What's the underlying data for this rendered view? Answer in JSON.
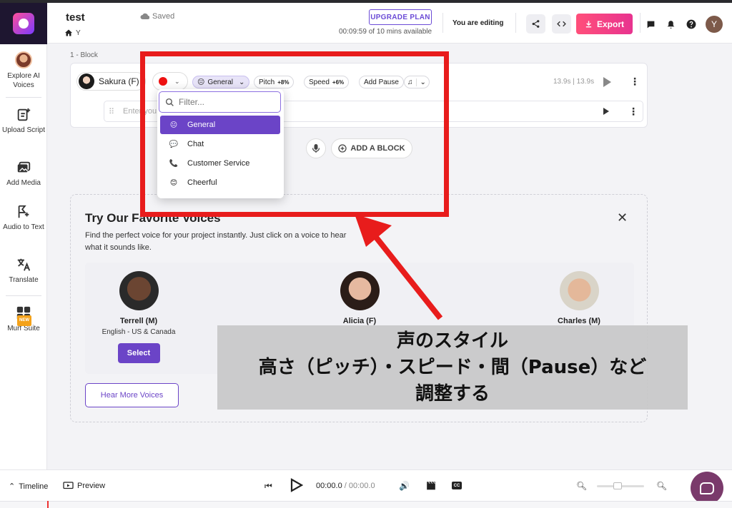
{
  "header": {
    "project_title": "test",
    "home_label": "Y",
    "saved_label": "Saved",
    "upgrade_label": "UPGRADE PLAN",
    "time_available": "00:09:59 of 10 mins available",
    "editing_label": "You are editing",
    "export_label": "Export",
    "user_initial": "Y"
  },
  "sidebar": {
    "items": [
      {
        "label": "Explore AI Voices",
        "icon": "avatar"
      },
      {
        "label": "Upload Script",
        "icon": "upload-script-icon"
      },
      {
        "label": "Add Media",
        "icon": "media-icon"
      },
      {
        "label": "Audio to Text",
        "icon": "audio-text-icon"
      },
      {
        "label": "Translate",
        "icon": "translate-icon"
      },
      {
        "label": "Murf Suite",
        "icon": "grid-icon",
        "badge": "NEW"
      }
    ]
  },
  "block": {
    "label": "1 -  Block",
    "voice_name": "Sakura (F)",
    "style": "General",
    "pitch_label": "Pitch",
    "pitch_value": "+8%",
    "speed_label": "Speed",
    "speed_value": "+6%",
    "add_pause_label": "Add Pause",
    "duration": "13.9s | 13.9s",
    "text_placeholder": "Enter you"
  },
  "style_dropdown": {
    "filter_placeholder": "Filter...",
    "options": [
      {
        "label": "General",
        "selected": true,
        "icon": "emoji-icon"
      },
      {
        "label": "Chat",
        "selected": false,
        "icon": "chat-icon"
      },
      {
        "label": "Customer Service",
        "selected": false,
        "icon": "phone-icon"
      },
      {
        "label": "Cheerful",
        "selected": false,
        "icon": "emoji-icon"
      }
    ]
  },
  "add_block_label": "ADD A BLOCK",
  "favorite_voices": {
    "title": "Try Our Favorite Voices",
    "description": "Find the perfect voice for your project instantly. Just click on a voice to hear what it sounds like.",
    "voices": [
      {
        "name": "Terrell (M)",
        "lang": "English - US & Canada",
        "select_label": "Select"
      },
      {
        "name": "Alicia (F)",
        "lang": "",
        "select_label": ""
      },
      {
        "name": "Charles (M)",
        "lang": "",
        "select_label": ""
      }
    ],
    "hear_more_label": "Hear More Voices"
  },
  "annotation": {
    "line1": "声のスタイル",
    "line2": "高さ（ピッチ）・スピード・間（Pause）など",
    "line3": "調整する",
    "color": "#e81c1c"
  },
  "bottombar": {
    "timeline_label": "Timeline",
    "preview_label": "Preview",
    "time_current": "00:00.0",
    "time_total": "/ 00:00.0"
  },
  "colors": {
    "accent": "#6b44c7",
    "export": "#ff4f7a"
  }
}
